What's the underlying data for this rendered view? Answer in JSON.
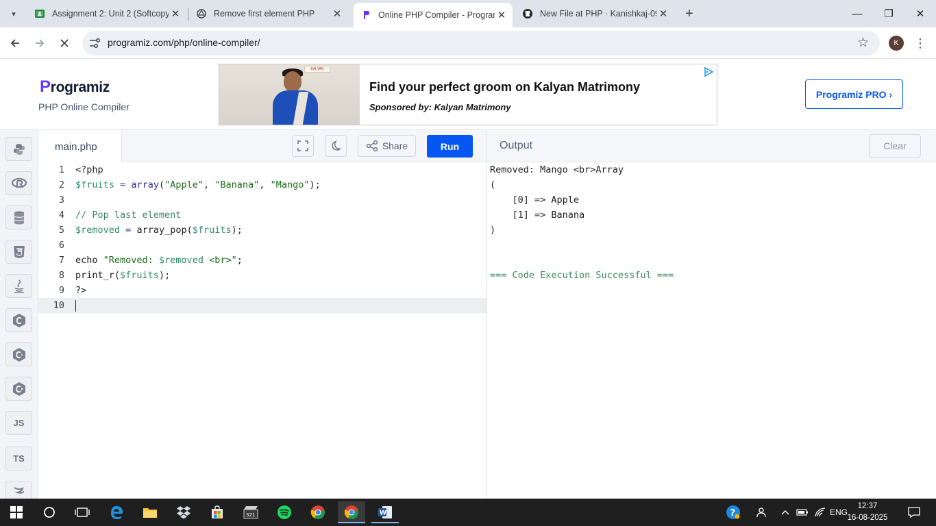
{
  "browser": {
    "tabs": [
      {
        "title": "Assignment 2: Unit 2 (Softcopy",
        "icon": "google-classroom-icon"
      },
      {
        "title": "Remove first element PHP",
        "icon": "chatgpt-icon"
      },
      {
        "title": "Online PHP Compiler - Program",
        "icon": "programiz-icon"
      },
      {
        "title": "New File at PHP · Kanishkaj-09/",
        "icon": "github-icon"
      }
    ],
    "url": "programiz.com/php/online-compiler/",
    "profile_initial": "K"
  },
  "header": {
    "logo": "rogramiz",
    "logo_p": "P",
    "subtitle": "PHP Online Compiler",
    "pro_button": "Programiz PRO ›"
  },
  "ad": {
    "title": "Find your perfect groom on Kalyan Matrimony",
    "sponsor": "Sponsored by: Kalyan Matrimony",
    "brand": "KALYAN"
  },
  "sidebar": {
    "languages": [
      "python-icon",
      "r-icon",
      "sql-icon",
      "html-icon",
      "java-icon",
      "c-icon",
      "cpp-icon",
      "csharp-icon",
      "JS",
      "TS",
      "swift-icon"
    ]
  },
  "editor": {
    "file_name": "main.php",
    "share_label": "Share",
    "run_label": "Run",
    "line_numbers": [
      "1",
      "2",
      "3",
      "4",
      "5",
      "6",
      "7",
      "8",
      "9",
      "10"
    ]
  },
  "output": {
    "title": "Output",
    "clear_label": "Clear",
    "lines": [
      "Removed: Mango <br>Array",
      "(",
      "    [0] => Apple",
      "    [1] => Banana",
      ")",
      "",
      "",
      "=== Code Execution Successful ==="
    ]
  },
  "taskbar": {
    "time": "12:37",
    "date": "16-08-2025",
    "language": "ENG"
  },
  "colors": {
    "brand_blue": "#0556f3",
    "brand_purple": "#6236ff"
  }
}
